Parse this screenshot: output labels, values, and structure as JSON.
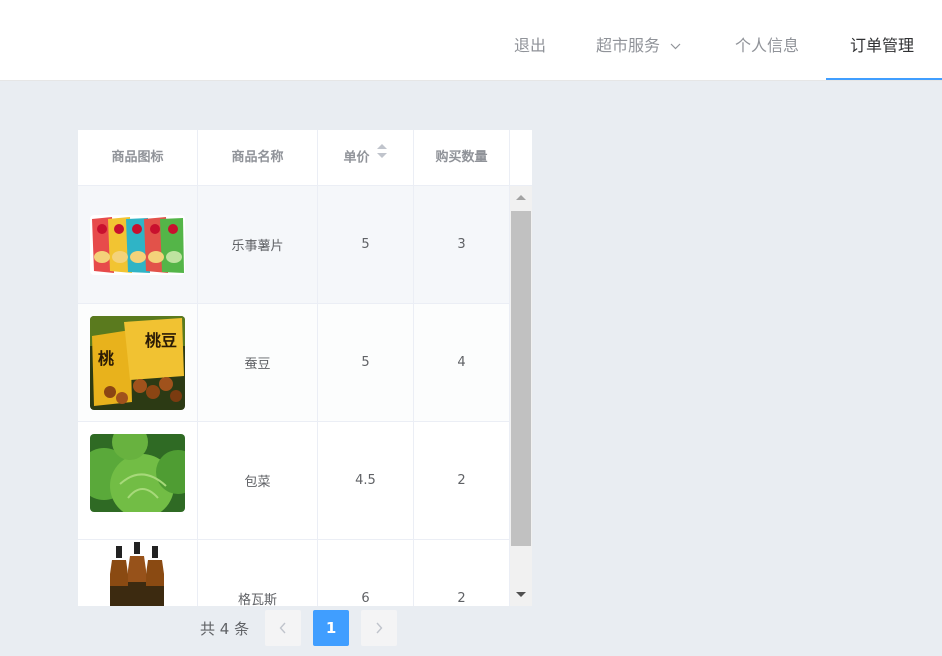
{
  "nav": {
    "logout": "退出",
    "service": "超市服务",
    "profile": "个人信息",
    "orders": "订单管理"
  },
  "table": {
    "headers": [
      "商品图标",
      "商品名称",
      "单价",
      "购买数量"
    ],
    "rows": [
      {
        "name": "乐事薯片",
        "price": "5",
        "qty": "3",
        "image": "chips-bags-image"
      },
      {
        "name": "蚕豆",
        "price": "5",
        "qty": "4",
        "image": "broad-beans-image"
      },
      {
        "name": "包菜",
        "price": "4.5",
        "qty": "2",
        "image": "cabbage-image"
      },
      {
        "name": "格瓦斯",
        "price": "6",
        "qty": "2",
        "image": "kvass-bottles-image"
      }
    ]
  },
  "pagination": {
    "total": "共 4 条",
    "current_page": "1"
  },
  "colors": {
    "accent": "#409eff",
    "background": "#e9edf2"
  }
}
